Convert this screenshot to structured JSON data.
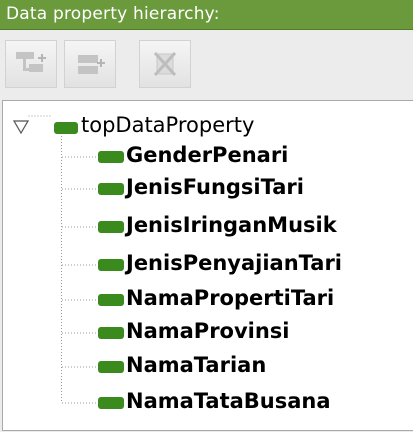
{
  "panel": {
    "title": "Data property hierarchy:"
  },
  "toolbar": {
    "buttons": [
      {
        "icon": "add-subproperty-icon",
        "enabled": false
      },
      {
        "icon": "add-sibling-property-icon",
        "enabled": false
      },
      {
        "icon": "delete-property-icon",
        "enabled": false
      }
    ]
  },
  "tree": {
    "root": {
      "label": "topDataProperty",
      "expanded": true,
      "icon": "data-property-icon"
    },
    "children": [
      {
        "label": "GenderPenari"
      },
      {
        "label": "JenisFungsiTari"
      },
      {
        "label": "JenisIringanMusik"
      },
      {
        "label": "JenisPenyajianTari"
      },
      {
        "label": "NamaPropertiTari"
      },
      {
        "label": "NamaProvinsi"
      },
      {
        "label": "NamaTarian"
      },
      {
        "label": "NamaTataBusana"
      }
    ]
  },
  "colors": {
    "title_bar": "#6b9a3c",
    "property_icon": "#3a8a1e"
  }
}
